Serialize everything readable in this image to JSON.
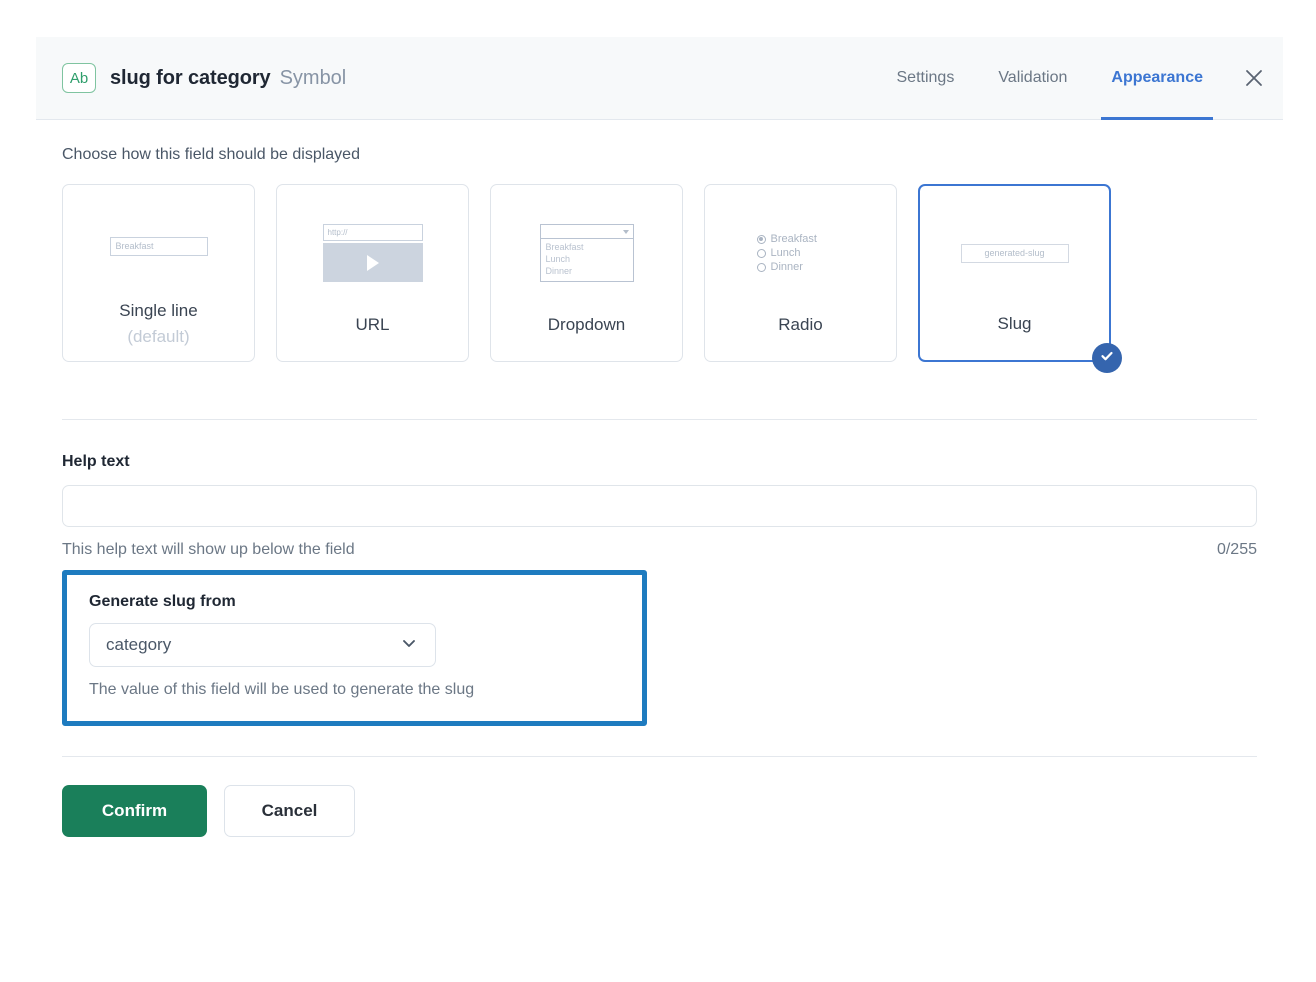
{
  "header": {
    "field_type_badge": "Ab",
    "title": "slug for category",
    "subtitle": "Symbol",
    "tabs": [
      {
        "label": "Settings",
        "active": false
      },
      {
        "label": "Validation",
        "active": false
      },
      {
        "label": "Appearance",
        "active": true
      }
    ],
    "close_icon": "close-icon",
    "active_tab_color": "#3c76d2"
  },
  "appearance": {
    "section_label": "Choose how this field should be displayed",
    "options": [
      {
        "name": "Single line",
        "sub": "(default)",
        "selected": false,
        "preview": {
          "type": "text-input",
          "value": "Breakfast"
        }
      },
      {
        "name": "URL",
        "sub": "",
        "selected": false,
        "preview": {
          "type": "url",
          "value": "http://",
          "play_icon": "play-icon"
        }
      },
      {
        "name": "Dropdown",
        "sub": "",
        "selected": false,
        "preview": {
          "type": "dropdown",
          "items": [
            "Breakfast",
            "Lunch",
            "Dinner"
          ]
        }
      },
      {
        "name": "Radio",
        "sub": "",
        "selected": false,
        "preview": {
          "type": "radio",
          "items": [
            "Breakfast",
            "Lunch",
            "Dinner"
          ],
          "checked_index": 0
        }
      },
      {
        "name": "Slug",
        "sub": "",
        "selected": true,
        "preview": {
          "type": "slug",
          "value": "generated-slug"
        }
      }
    ],
    "selected_badge_icon": "check-icon",
    "selected_color": "#3c76d2"
  },
  "help_text": {
    "label": "Help text",
    "value": "",
    "placeholder": "",
    "hint": "This help text will show up below the field",
    "counter": "0/255"
  },
  "slug_source": {
    "label": "Generate slug from",
    "selected_value": "category",
    "chevron_icon": "chevron-down-icon",
    "hint": "The value of this field will be used to generate the slug",
    "highlight_color": "#1e7bbf"
  },
  "footer": {
    "confirm_label": "Confirm",
    "cancel_label": "Cancel",
    "confirm_color": "#1a7f5a"
  }
}
